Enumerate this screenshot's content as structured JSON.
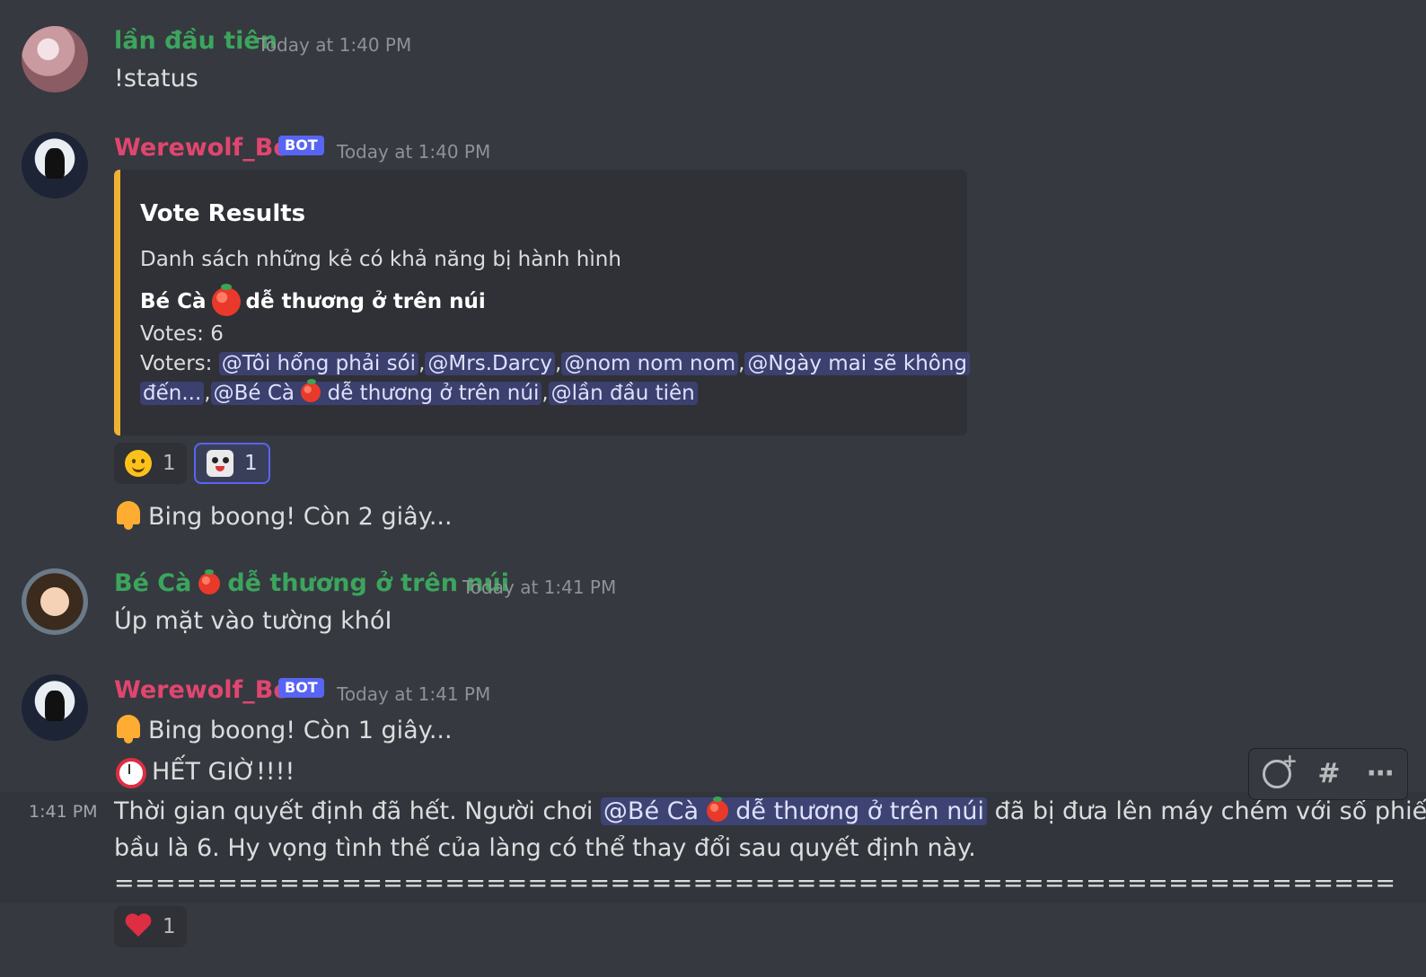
{
  "messages": [
    {
      "author": "lần đầu tiên",
      "timestamp": "Today at 1:40 PM",
      "content": "!status"
    },
    {
      "author": "Werewolf_Bot",
      "badge": "BOT",
      "timestamp": "Today at 1:40 PM",
      "embed": {
        "title": "Vote Results",
        "description": "Danh sách những kẻ có khả năng bị hành hình",
        "field_name_prefix": "Bé Cà",
        "field_name_suffix": "dễ thương ở trên núi",
        "votes": "Votes: 6",
        "voters_label": "Voters:",
        "voters": [
          "@Tôi hổng phải sói",
          "@Mrs.Darcy",
          "@nom nom nom",
          "@Ngày mai sẽ không",
          "đến...",
          "@Bé Cà",
          "dễ thương ở trên núi",
          "@lần đầu tiên"
        ]
      },
      "reactions": [
        {
          "emoji": "slightly-smiling-face",
          "count": "1"
        },
        {
          "emoji": "custom-cat-emoji",
          "count": "1"
        }
      ],
      "followup": "Bing boong! Còn 2 giây..."
    },
    {
      "author_prefix": "Bé Cà",
      "author_suffix": "dễ thương ở trên núi",
      "timestamp": "Today at 1:41 PM",
      "content": "Úp mặt vào tường khóI"
    },
    {
      "author": "Werewolf_Bot",
      "badge": "BOT",
      "timestamp": "Today at 1:41 PM",
      "line1": "Bing boong! Còn 1 giây...",
      "line2": "HẾT GIỜ!!!!",
      "hover_time": "1:41 PM",
      "line3_start": "Thời gian quyết định đã hết. Người chơi",
      "mention_prefix": "@Bé Cà",
      "mention_suffix": "dễ thương ở trên núi",
      "line3_end": "đã bị đưa lên máy chém với số phiếu",
      "line4": "bầu là 6. Hy vọng tình thế của làng có thể thay đổi sau quyết định này.",
      "line5": "==============================================================",
      "reactions": [
        {
          "emoji": "red-heart",
          "count": "1"
        }
      ]
    }
  ],
  "colors": {
    "background": "#36393f",
    "green_name": "#3ba55d",
    "bot_name": "#e0466f",
    "bot_badge": "#5865f2",
    "embed_border": "#f0b232"
  }
}
